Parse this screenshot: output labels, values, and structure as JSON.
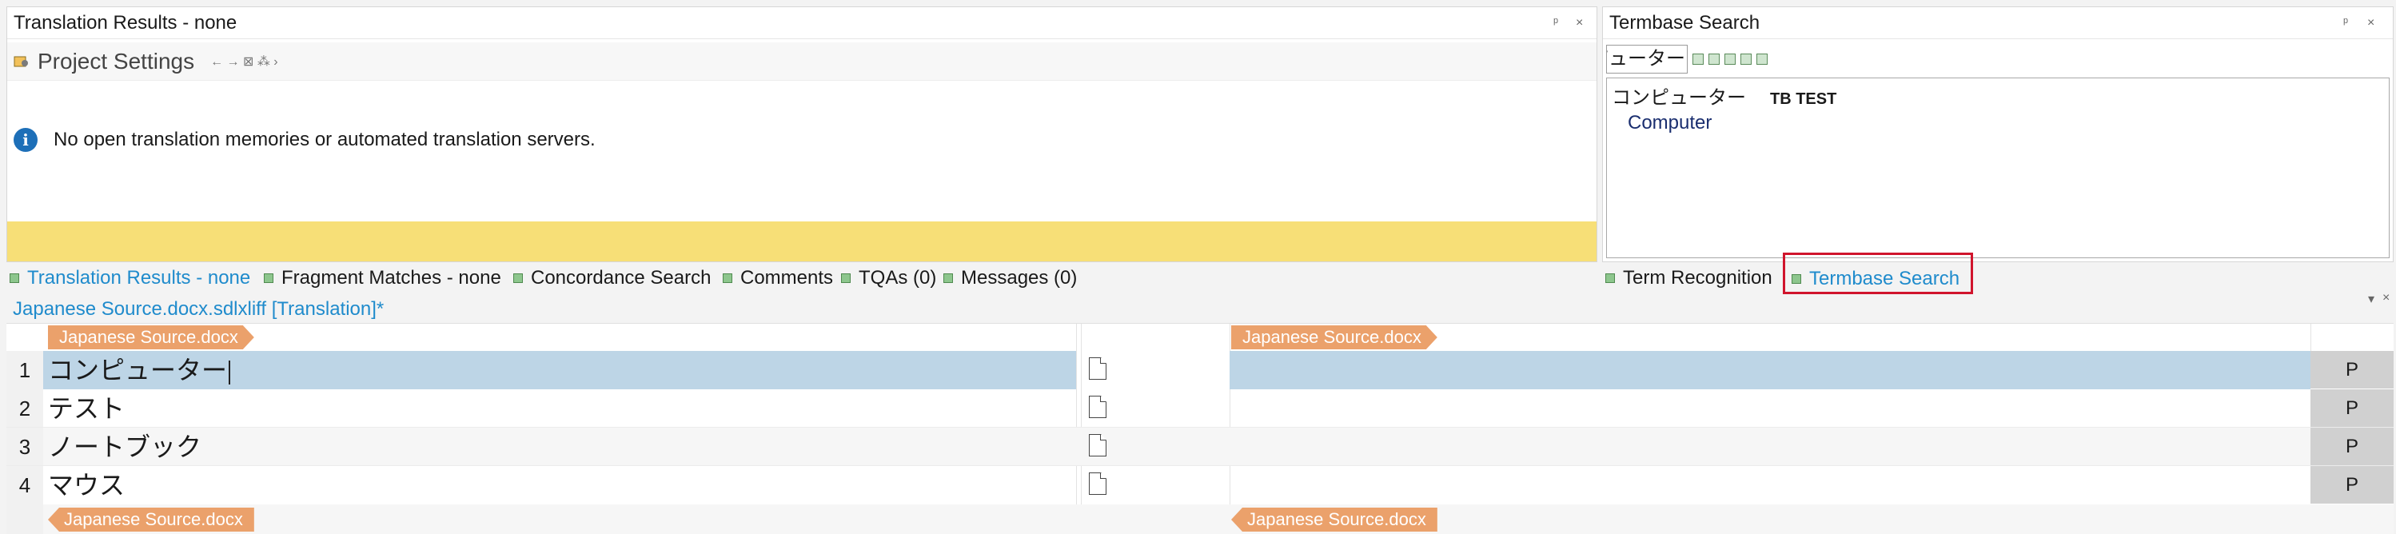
{
  "translation_results": {
    "title": "Translation Results - none",
    "pin_glyph": "ᵖ",
    "close_glyph": "×",
    "toolbar": {
      "project_settings_label": "Project Settings",
      "nav_glyphs": "← → ⊠ ⁂ ›"
    },
    "message": "No open translation memories or automated translation servers."
  },
  "termbase_search": {
    "title": "Termbase Search",
    "pin_glyph": "ᵖ",
    "close_glyph": "×",
    "query": "コンピューター",
    "results": {
      "source_term": "コンピューター",
      "termbase_name": "TB TEST",
      "target_term": "Computer"
    }
  },
  "tabs": {
    "translation_results": "Translation Results - none",
    "fragment_matches": "Fragment Matches - none",
    "concordance_search": "Concordance Search",
    "comments": "Comments",
    "tqas": "TQAs (0)",
    "messages": "Messages (0)",
    "term_recognition": "Term Recognition",
    "termbase_search": "Termbase Search"
  },
  "editor": {
    "document_tab": "Japanese Source.docx.sdlxliff [Translation]*",
    "file_tag": "Japanese Source.docx",
    "segments": [
      {
        "num": "1",
        "source": "コンピューター",
        "status": "P"
      },
      {
        "num": "2",
        "source": "テスト",
        "status": "P"
      },
      {
        "num": "3",
        "source": "ノートブック",
        "status": "P"
      },
      {
        "num": "4",
        "source": "マウス",
        "status": "P"
      }
    ]
  },
  "colors": {
    "accent": "#1f8bcc",
    "highlight_yellow": "#f7df77",
    "selected_row": "#bdd5e6",
    "file_tag": "#eba16b",
    "focus_outline": "#d0142c"
  }
}
